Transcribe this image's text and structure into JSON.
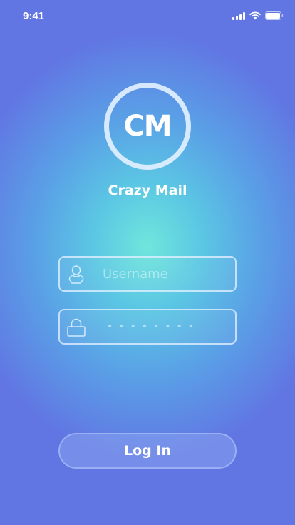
{
  "status_bar": {
    "time": "9:41",
    "icons": [
      "signal-icon",
      "wifi-icon",
      "battery-icon"
    ]
  },
  "logo": {
    "initials": "CM",
    "app_name": "Crazy Mail"
  },
  "form": {
    "username": {
      "placeholder": "Username",
      "value": "",
      "icon": "user-icon"
    },
    "password": {
      "masked_value": "••••••••",
      "icon": "lock-icon"
    },
    "login_label": "Log In"
  },
  "colors": {
    "gradient_center": "#6fe6dc",
    "gradient_mid": "#5a9fe6",
    "gradient_edge": "#6176e3",
    "text": "#ffffff"
  }
}
